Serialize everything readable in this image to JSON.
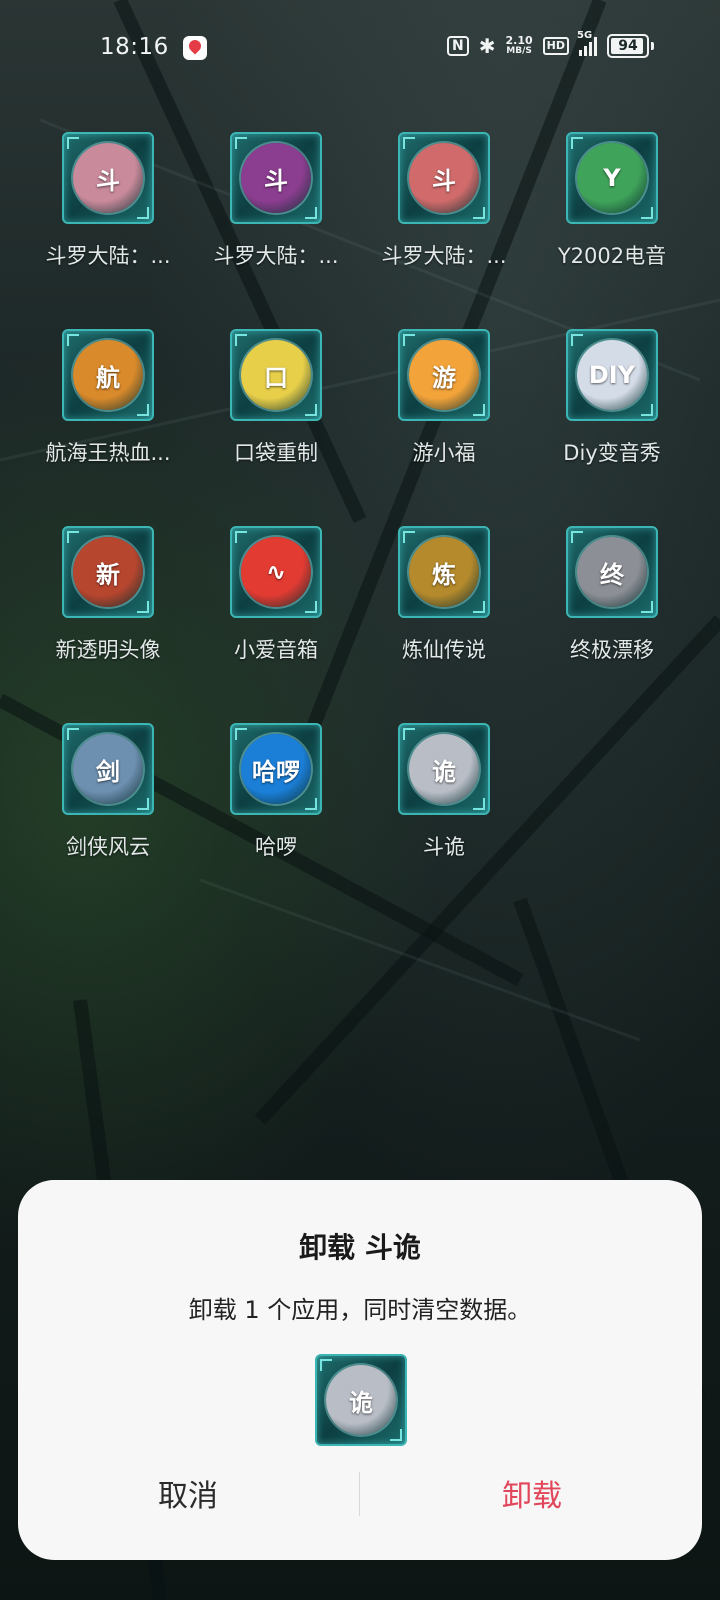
{
  "status_bar": {
    "time": "18:16",
    "nfc_icon": "N",
    "bluetooth_icon": "✱",
    "net_speed_value": "2.10",
    "net_speed_unit": "MB/S",
    "hd_label": "HD",
    "signal_label": "5G",
    "battery_percent": "94",
    "battery_level": 94
  },
  "apps": [
    {
      "label": "斗罗大陆：...",
      "icon": "game-character-icon",
      "color": "#c98a9b",
      "glyph": "斗"
    },
    {
      "label": "斗罗大陆：...",
      "icon": "game-character-icon",
      "color": "#8b3d8f",
      "glyph": "斗"
    },
    {
      "label": "斗罗大陆：...",
      "icon": "game-character-icon",
      "color": "#d16b6b",
      "glyph": "斗"
    },
    {
      "label": "Y2002电音",
      "icon": "cube-icon",
      "color": "#3fa45a",
      "glyph": "Y"
    },
    {
      "label": "航海王热血...",
      "icon": "pirate-character-icon",
      "color": "#d98a2b",
      "glyph": "航"
    },
    {
      "label": "口袋重制",
      "icon": "pokemon-icon",
      "color": "#e8cf4a",
      "glyph": "口"
    },
    {
      "label": "游小福",
      "icon": "tiger-gamepad-icon",
      "color": "#f2a33a",
      "glyph": "游"
    },
    {
      "label": "Diy变音秀",
      "icon": "diy-logo-icon",
      "color": "#d4dce8",
      "glyph": "DIY"
    },
    {
      "label": "新透明头像",
      "icon": "cartoon-avatar-icon",
      "color": "#b7462f",
      "glyph": "新"
    },
    {
      "label": "小爱音箱",
      "icon": "sound-wave-icon",
      "color": "#e23b32",
      "glyph": "∿"
    },
    {
      "label": "炼仙传说",
      "icon": "lion-warrior-icon",
      "color": "#b58a2c",
      "glyph": "炼"
    },
    {
      "label": "终极漂移",
      "icon": "car-icon",
      "color": "#8d8f96",
      "glyph": "终"
    },
    {
      "label": "剑侠风云",
      "icon": "swordsman-icon",
      "color": "#6d8fb0",
      "glyph": "剑"
    },
    {
      "label": "哈啰",
      "icon": "hello-logo-icon",
      "color": "#1b7fd8",
      "glyph": "哈啰"
    },
    {
      "label": "斗诡",
      "icon": "white-hair-character-icon",
      "color": "#b8bdc6",
      "glyph": "诡"
    }
  ],
  "dialog": {
    "title": "卸载 斗诡",
    "message": "卸载 1 个应用，同时清空数据。",
    "icon_glyph": "诡",
    "icon_color": "#b8bdc6",
    "cancel_label": "取消",
    "uninstall_label": "卸载"
  }
}
